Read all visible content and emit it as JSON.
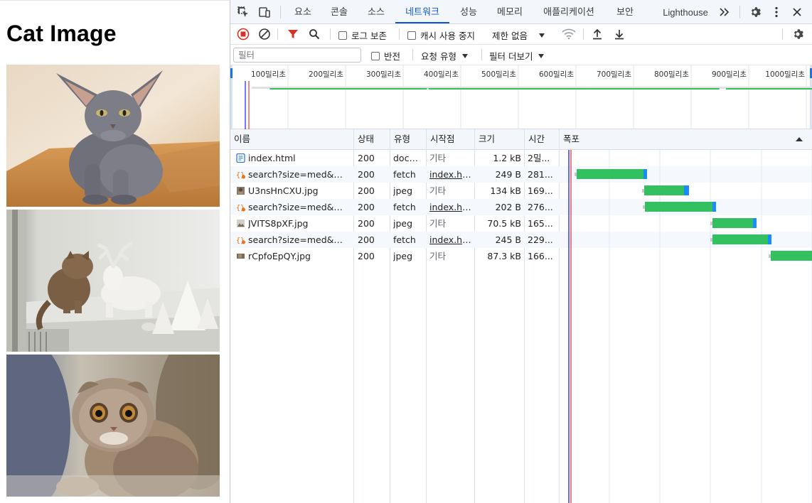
{
  "page": {
    "title": "Cat Image",
    "images": [
      {
        "alt": "cat-1"
      },
      {
        "alt": "cat-2"
      },
      {
        "alt": "cat-3"
      }
    ]
  },
  "devtools": {
    "tabs": [
      {
        "label": "요소",
        "active": false
      },
      {
        "label": "콘솔",
        "active": false
      },
      {
        "label": "소스",
        "active": false
      },
      {
        "label": "네트워크",
        "active": true
      },
      {
        "label": "성능",
        "active": false
      },
      {
        "label": "메모리",
        "active": false
      },
      {
        "label": "애플리케이션",
        "active": false
      },
      {
        "label": "보안",
        "active": false
      },
      {
        "label": "Lighthouse",
        "active": false
      }
    ],
    "more_tabs_icon": "chevrons-right-icon",
    "toolbar": {
      "preserve_log_label": "로그 보존",
      "disable_cache_label": "캐시 사용 중지",
      "throttling_value": "제한 없음"
    },
    "filter_bar": {
      "filter_placeholder": "필터",
      "invert_label": "반전",
      "request_type_label": "요청 유형",
      "more_filters_label": "필터 더보기"
    },
    "overview": {
      "ticks": [
        "100밀리초",
        "200밀리초",
        "300밀리초",
        "400밀리초",
        "500밀리초",
        "600밀리초",
        "700밀리초",
        "800밀리초",
        "900밀리초",
        "1000밀리초"
      ]
    },
    "columns": [
      "이름",
      "상태",
      "유형",
      "시작점",
      "크기",
      "시간",
      "폭포"
    ],
    "rows": [
      {
        "name": "index.html",
        "icon": "document-icon",
        "status": "200",
        "type": "docu...",
        "initiator": "기타",
        "initiator_link": false,
        "size": "1.2 kB",
        "time": "2밀...",
        "wf_start": 0,
        "wf_wait": 0,
        "wf_download": 0
      },
      {
        "name": "search?size=med&mi...",
        "icon": "fetch-icon",
        "status": "200",
        "type": "fetch",
        "initiator": "index.ht...",
        "initiator_link": true,
        "size": "249 B",
        "time": "281...",
        "wf_start": 10,
        "wf_wait": 94,
        "wf_download": 5
      },
      {
        "name": "U3nsHnCXU.jpg",
        "icon": "image-icon",
        "status": "200",
        "type": "jpeg",
        "initiator": "기타",
        "initiator_link": false,
        "size": "134 kB",
        "time": "169...",
        "wf_start": 105,
        "wf_wait": 56,
        "wf_download": 7
      },
      {
        "name": "search?size=med&mi...",
        "icon": "fetch-icon",
        "status": "200",
        "type": "fetch",
        "initiator": "index.ht...",
        "initiator_link": true,
        "size": "202 B",
        "time": "276...",
        "wf_start": 106,
        "wf_wait": 95,
        "wf_download": 5
      },
      {
        "name": "JVITS8pXF.jpg",
        "icon": "image-icon",
        "status": "200",
        "type": "jpeg",
        "initiator": "기타",
        "initiator_link": false,
        "size": "70.5 kB",
        "time": "165...",
        "wf_start": 201,
        "wf_wait": 57,
        "wf_download": 5
      },
      {
        "name": "search?size=med&mi...",
        "icon": "fetch-icon",
        "status": "200",
        "type": "fetch",
        "initiator": "index.ht...",
        "initiator_link": true,
        "size": "245 B",
        "time": "229...",
        "wf_start": 201,
        "wf_wait": 78,
        "wf_download": 5
      },
      {
        "name": "rCpfoEpQY.jpg",
        "icon": "image-icon",
        "status": "200",
        "type": "jpeg",
        "initiator": "기타",
        "initiator_link": false,
        "size": "87.3 kB",
        "time": "166...",
        "wf_start": 283,
        "wf_wait": 60,
        "wf_download": 0
      }
    ],
    "colors": {
      "accent": "#0b57d0",
      "record": "#d93025",
      "filter_red": "#d93025",
      "waterfall_wait": "#33c060",
      "waterfall_download": "#1a8cff",
      "dom_content_loaded": "#1a1aff",
      "load": "#e53935"
    }
  }
}
